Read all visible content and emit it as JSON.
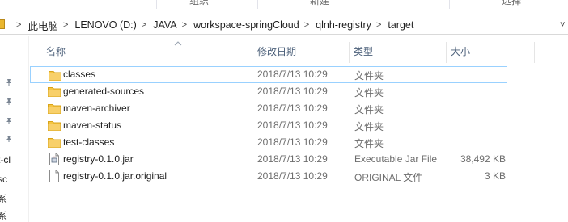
{
  "ribbon": {
    "groups": [
      "组织",
      "新建",
      "选择"
    ]
  },
  "address": {
    "crumbs": [
      "此电脑",
      "LENOVO (D:)",
      "JAVA",
      "workspace-springCloud",
      "qlnh-registry",
      "target"
    ]
  },
  "nav": {
    "texts": [
      "t-cl",
      "sc",
      "系",
      "系"
    ]
  },
  "columns": {
    "name": "名称",
    "date": "修改日期",
    "type": "类型",
    "size": "大小"
  },
  "files": [
    {
      "name": "classes",
      "date": "2018/7/13 10:29",
      "type": "文件夹",
      "size": "",
      "icon": "folder-icon"
    },
    {
      "name": "generated-sources",
      "date": "2018/7/13 10:29",
      "type": "文件夹",
      "size": "",
      "icon": "folder-icon"
    },
    {
      "name": "maven-archiver",
      "date": "2018/7/13 10:29",
      "type": "文件夹",
      "size": "",
      "icon": "folder-icon"
    },
    {
      "name": "maven-status",
      "date": "2018/7/13 10:29",
      "type": "文件夹",
      "size": "",
      "icon": "folder-icon"
    },
    {
      "name": "test-classes",
      "date": "2018/7/13 10:29",
      "type": "文件夹",
      "size": "",
      "icon": "folder-icon"
    },
    {
      "name": "registry-0.1.0.jar",
      "date": "2018/7/13 10:29",
      "type": "Executable Jar File",
      "size": "38,492 KB",
      "icon": "jar-file-icon"
    },
    {
      "name": "registry-0.1.0.jar.original",
      "date": "2018/7/13 10:29",
      "type": "ORIGINAL 文件",
      "size": "3 KB",
      "icon": "file-icon"
    }
  ],
  "colors": {
    "folder": "#f5c543",
    "header_text": "#4c607a",
    "focus_border": "#99d1ff"
  }
}
